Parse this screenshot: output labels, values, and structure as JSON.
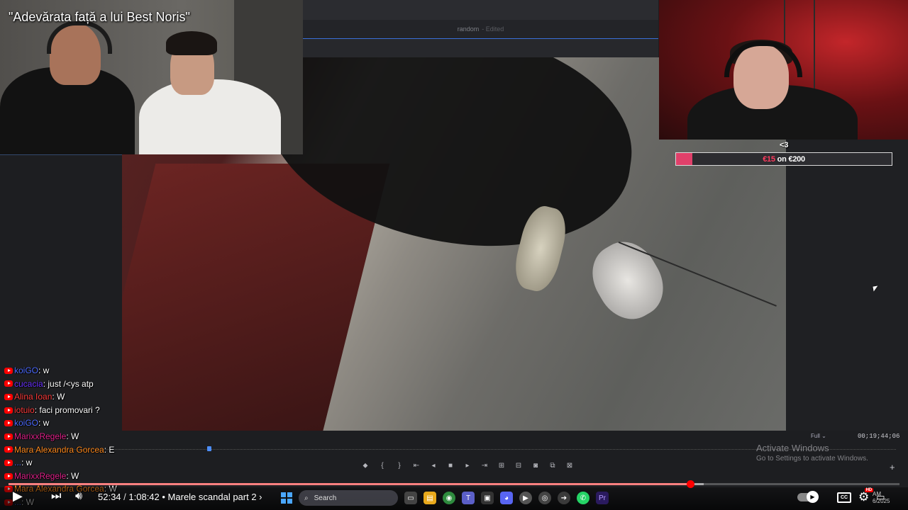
{
  "stream": {
    "caption": "\"Adevărata față a lui Best Noris\""
  },
  "editor": {
    "title": "random",
    "status": "- Edited",
    "zoom": "Full",
    "timecode": "00;19;44;06",
    "transport_icons": [
      "marker-icon",
      "mark-in-icon",
      "mark-out-icon",
      "go-to-in-icon",
      "step-back-icon",
      "stop-icon",
      "step-forward-icon",
      "go-to-out-icon",
      "lift-icon",
      "extract-icon",
      "camera-icon",
      "compare-icon",
      "export-frame-icon"
    ]
  },
  "goal": {
    "label": "<3",
    "current": "€15",
    "connector": "on",
    "target": "€200",
    "progress": 0.075,
    "fill_color": "#e0406a"
  },
  "chat": [
    {
      "user": "koiGO",
      "color": "#4d6bff",
      "message": ": w"
    },
    {
      "user": "cucacia",
      "color": "#6a32ff",
      "message": ": just /<ys atp"
    },
    {
      "user": "Alina Ioan",
      "color": "#ff3c3c",
      "message": ": W"
    },
    {
      "user": "iotuio",
      "color": "#ff3c3c",
      "message": ": faci promovari ?"
    },
    {
      "user": "koiGO",
      "color": "#4d6bff",
      "message": ": w"
    },
    {
      "user": "MarixxRegele",
      "color": "#e0218a",
      "message": ": W"
    },
    {
      "user": "Mara Alexandra Gorcea",
      "color": "#ff8a1e",
      "message": ": E"
    },
    {
      "user": "...",
      "color": "#4d6bff",
      "message": ": w"
    },
    {
      "user": "MarixxRegele",
      "color": "#e0218a",
      "message": ": W"
    },
    {
      "user": "Mara Alexandra Gorcea",
      "color": "#ff8a1e",
      "message": ": W"
    },
    {
      "user": "...",
      "color": "#4d6bff",
      "message": ": W"
    }
  ],
  "windows_watermark": {
    "line1": "Activate Windows",
    "line2": "Go to Settings to activate Windows."
  },
  "player": {
    "current_time": "52:34",
    "duration": "1:08:42",
    "separator": " / ",
    "chapter": "• Marele scandal part 2 ›",
    "played_fraction": 0.765,
    "buffered_fraction": 0.78,
    "accent": "#ff0000"
  },
  "taskbar": {
    "search_placeholder": "Search",
    "clock": "AM",
    "date": "6/2025"
  }
}
